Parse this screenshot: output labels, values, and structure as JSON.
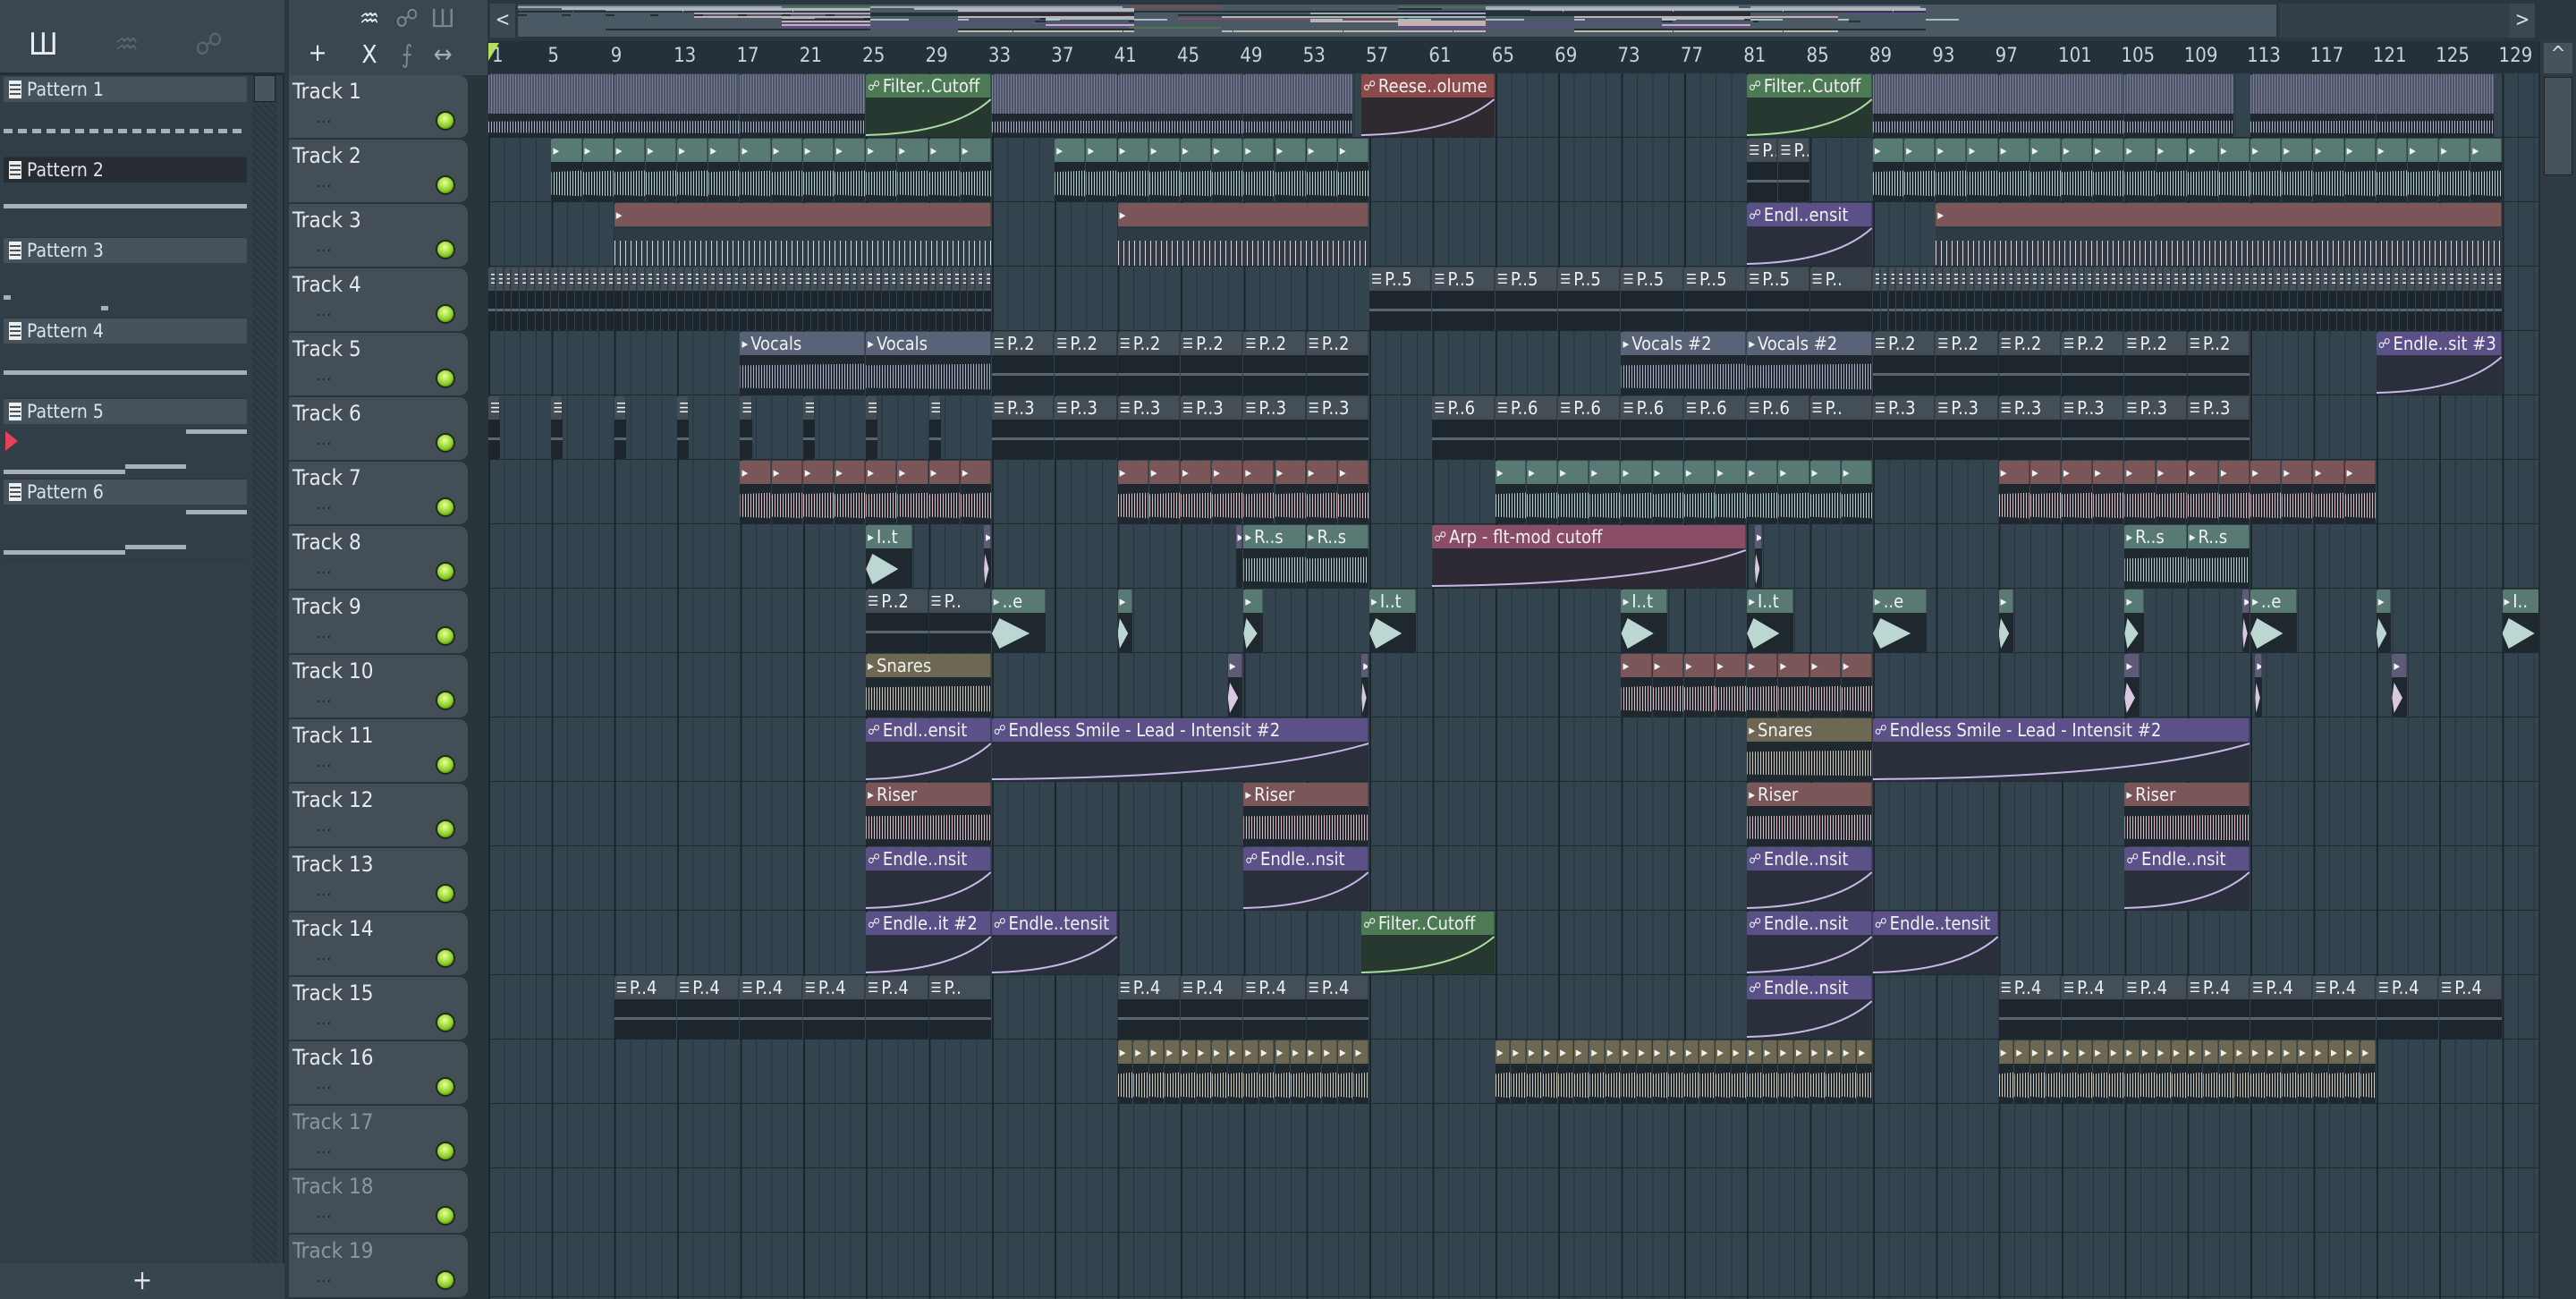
{
  "picker": {
    "icons": [
      "piano-roll-icon",
      "audio-clip-icon",
      "automation-icon"
    ],
    "patterns": [
      {
        "name": "Pattern 1",
        "selected": false
      },
      {
        "name": "Pattern 2",
        "selected": true
      },
      {
        "name": "Pattern 3",
        "selected": false
      },
      {
        "name": "Pattern 4",
        "selected": false
      },
      {
        "name": "Pattern 5",
        "selected": false
      },
      {
        "name": "Pattern 6",
        "selected": false
      }
    ],
    "add_label": "+",
    "current_marker": "Pattern 5"
  },
  "toolbar": {
    "add": "+",
    "delete": "X",
    "slice": "⨍",
    "stretch": "↔",
    "wave": "♒",
    "auto": "☍",
    "piano": "Ш"
  },
  "overview": {
    "left": "<",
    "right": ">"
  },
  "ruler": [
    "1",
    "5",
    "9",
    "13",
    "17",
    "21",
    "25",
    "29",
    "33",
    "37",
    "41",
    "45",
    "49",
    "53",
    "57",
    "61",
    "65",
    "69",
    "73",
    "77",
    "81",
    "85",
    "89",
    "93",
    "97",
    "101",
    "105",
    "109",
    "113",
    "117",
    "121",
    "125",
    "129"
  ],
  "colors": {
    "lavender": [
      "#5a6278",
      "#b4b9d2"
    ],
    "teal": [
      "#587a72",
      "#bcd6d2"
    ],
    "pink": [
      "#7a5658",
      "#e8c2ca"
    ],
    "tan": [
      "#6e6852",
      "#d8d0bc"
    ],
    "pattern": [
      "#434e56",
      "#1c262c"
    ],
    "auto_purple": [
      "#5c5088",
      "#2a2f3c"
    ],
    "auto_green": [
      "#4d7a55",
      "#273830"
    ],
    "auto_red": [
      "#8c4a4a",
      "#2e2a30"
    ],
    "auto_pink": [
      "#8a4c66",
      "#2e2a34"
    ],
    "small_purple": [
      "#5e5a78",
      "#1c262c"
    ]
  },
  "tracks": [
    {
      "name": "Track 1",
      "clips": [
        {
          "t": "audio",
          "c": "lavender",
          "s": 1,
          "l": 8,
          "n": 3
        },
        {
          "t": "auto",
          "c": "auto_green",
          "name": "Filter..Cutoff",
          "s": 25,
          "l": 8
        },
        {
          "t": "audio",
          "c": "lavender",
          "s": 33,
          "l": 8,
          "n": 2
        },
        {
          "t": "audio",
          "c": "lavender",
          "s": 49,
          "l": 7
        },
        {
          "t": "auto",
          "c": "auto_red",
          "name": "Reese..olume",
          "s": 56.5,
          "l": 8.5
        },
        {
          "t": "auto",
          "c": "auto_green",
          "name": "Filter..Cutoff",
          "s": 81,
          "l": 8
        },
        {
          "t": "audio",
          "c": "lavender",
          "s": 89,
          "l": 8,
          "n": 2
        },
        {
          "t": "audio",
          "c": "lavender",
          "s": 105,
          "l": 7
        },
        {
          "t": "audio",
          "c": "lavender",
          "s": 113,
          "l": 8
        },
        {
          "t": "audio",
          "c": "lavender",
          "s": 121,
          "l": 7.5
        }
      ]
    },
    {
      "name": "Track 2",
      "clips": [
        {
          "t": "audio",
          "c": "teal",
          "hicon": true,
          "s": 5,
          "l": 2,
          "n": 14
        },
        {
          "t": "audio",
          "c": "teal",
          "hicon": true,
          "s": 37,
          "l": 2,
          "n": 10
        },
        {
          "t": "pattern",
          "c": "pattern",
          "name": "P..2",
          "s": 81,
          "l": 2
        },
        {
          "t": "pattern",
          "c": "pattern",
          "name": "P..",
          "s": 83,
          "l": 2
        },
        {
          "t": "audio",
          "c": "teal",
          "hicon": true,
          "s": 89,
          "l": 2,
          "n": 20
        }
      ]
    },
    {
      "name": "Track 3",
      "clips": [
        {
          "t": "lines",
          "c": "pink",
          "s": 9,
          "l": 24
        },
        {
          "t": "lines",
          "c": "pink",
          "s": 41,
          "l": 16
        },
        {
          "t": "auto",
          "c": "auto_purple",
          "name": "Endl..ensit",
          "s": 81,
          "l": 8
        },
        {
          "t": "lines",
          "c": "pink",
          "s": 93,
          "l": 36
        }
      ]
    },
    {
      "name": "Track 4",
      "clips": [
        {
          "t": "pattern",
          "c": "pattern",
          "s": 1,
          "l": 0.5,
          "n": 64
        },
        {
          "t": "pattern",
          "c": "pattern",
          "name": "P..5",
          "s": 57,
          "l": 4,
          "n": 7
        },
        {
          "t": "pattern",
          "c": "pattern",
          "name": "P..",
          "s": 85,
          "l": 4
        },
        {
          "t": "pattern",
          "c": "pattern",
          "s": 89,
          "l": 0.5,
          "n": 80
        }
      ]
    },
    {
      "name": "Track 5",
      "clips": [
        {
          "t": "audio",
          "c": "lavender",
          "name": "Vocals",
          "s": 17,
          "l": 8,
          "n": 2
        },
        {
          "t": "pattern",
          "c": "pattern",
          "name": "P..2",
          "s": 33,
          "l": 4,
          "n": 6
        },
        {
          "t": "audio",
          "c": "lavender",
          "name": "Vocals #2",
          "s": 73,
          "l": 8,
          "n": 2
        },
        {
          "t": "pattern",
          "c": "pattern",
          "name": "P..2",
          "s": 89,
          "l": 4,
          "n": 6
        },
        {
          "t": "auto",
          "c": "auto_purple",
          "name": "Endle..sit #3",
          "s": 121,
          "l": 8
        }
      ]
    },
    {
      "name": "Track 6",
      "clips": [
        {
          "t": "pattern",
          "c": "pattern",
          "s": 1,
          "l": 0.8,
          "step": 4,
          "n": 8
        },
        {
          "t": "pattern",
          "c": "pattern",
          "name": "P..3",
          "s": 33,
          "l": 4,
          "n": 6
        },
        {
          "t": "pattern",
          "c": "pattern",
          "name": "P..6",
          "s": 61,
          "l": 4,
          "n": 6
        },
        {
          "t": "pattern",
          "c": "pattern",
          "name": "P..",
          "s": 85,
          "l": 4
        },
        {
          "t": "pattern",
          "c": "pattern",
          "name": "P..3",
          "s": 89,
          "l": 4,
          "n": 6
        }
      ]
    },
    {
      "name": "Track 7",
      "clips": [
        {
          "t": "audio",
          "c": "pink",
          "hicon": true,
          "s": 17,
          "l": 2,
          "n": 8
        },
        {
          "t": "audio",
          "c": "pink",
          "hicon": true,
          "s": 41,
          "l": 2,
          "n": 8
        },
        {
          "t": "audio",
          "c": "teal",
          "hicon": true,
          "s": 65,
          "l": 2,
          "n": 12
        },
        {
          "t": "audio",
          "c": "pink",
          "hicon": true,
          "s": 97,
          "l": 2,
          "n": 12
        }
      ]
    },
    {
      "name": "Track 8",
      "clips": [
        {
          "t": "hit",
          "c": "teal",
          "name": "I..t",
          "s": 25,
          "l": 3
        },
        {
          "t": "hit",
          "c": "small_purple",
          "s": 32.5,
          "l": 0.5
        },
        {
          "t": "audio",
          "c": "small_purple",
          "s": 48.5,
          "l": 0.5
        },
        {
          "t": "audio",
          "c": "teal",
          "name": "R..s",
          "s": 49,
          "l": 4,
          "n": 2
        },
        {
          "t": "auto",
          "c": "auto_pink",
          "name": "Arp - flt-mod cutoff",
          "s": 61,
          "l": 20
        },
        {
          "t": "hit",
          "c": "small_purple",
          "s": 81.5,
          "l": 0.5
        },
        {
          "t": "audio",
          "c": "teal",
          "name": "R..s",
          "s": 105,
          "l": 4,
          "n": 2
        }
      ]
    },
    {
      "name": "Track 9",
      "clips": [
        {
          "t": "pattern",
          "c": "pattern",
          "name": "P..2",
          "s": 25,
          "l": 4
        },
        {
          "t": "pattern",
          "c": "pattern",
          "name": "P..",
          "s": 29,
          "l": 4
        },
        {
          "t": "hit",
          "c": "teal",
          "name": "..e",
          "s": 33,
          "l": 3.5
        },
        {
          "t": "hit",
          "c": "teal",
          "s": 41,
          "l": 1
        },
        {
          "t": "hit",
          "c": "teal",
          "s": 49,
          "l": 1.3
        },
        {
          "t": "hit",
          "c": "teal",
          "name": "I..t",
          "s": 57,
          "l": 3
        },
        {
          "t": "hit",
          "c": "teal",
          "name": "I..t",
          "s": 73,
          "l": 3
        },
        {
          "t": "hit",
          "c": "teal",
          "name": "I..t",
          "s": 81,
          "l": 3
        },
        {
          "t": "hit",
          "c": "teal",
          "name": "..e",
          "s": 89,
          "l": 3.5
        },
        {
          "t": "hit",
          "c": "teal",
          "s": 97,
          "l": 1
        },
        {
          "t": "hit",
          "c": "teal",
          "s": 105,
          "l": 1.3
        },
        {
          "t": "hit",
          "c": "small_purple",
          "s": 112.5,
          "l": 0.5
        },
        {
          "t": "hit",
          "c": "teal",
          "name": "..e",
          "s": 113,
          "l": 3
        },
        {
          "t": "hit",
          "c": "teal",
          "s": 121,
          "l": 1
        },
        {
          "t": "hit",
          "c": "teal",
          "name": "I..",
          "s": 129,
          "l": 3
        }
      ]
    },
    {
      "name": "Track 10",
      "clips": [
        {
          "t": "audio",
          "c": "tan",
          "name": "Snares",
          "s": 25,
          "l": 8
        },
        {
          "t": "hit",
          "c": "small_purple",
          "s": 48,
          "l": 1
        },
        {
          "t": "hit",
          "c": "small_purple",
          "s": 56.5,
          "l": 0.5
        },
        {
          "t": "audio",
          "c": "pink",
          "hicon": true,
          "s": 73,
          "l": 2,
          "n": 8
        },
        {
          "t": "hit",
          "c": "small_purple",
          "s": 105,
          "l": 1
        },
        {
          "t": "hit",
          "c": "small_purple",
          "s": 113.3,
          "l": 0.5
        },
        {
          "t": "hit",
          "c": "small_purple",
          "s": 122,
          "l": 1
        }
      ]
    },
    {
      "name": "Track 11",
      "clips": [
        {
          "t": "auto",
          "c": "auto_purple",
          "name": "Endl..ensit",
          "s": 25,
          "l": 8
        },
        {
          "t": "auto",
          "c": "auto_purple",
          "name": "Endless Smile - Lead - Intensit #2",
          "s": 33,
          "l": 24
        },
        {
          "t": "audio",
          "c": "tan",
          "name": "Snares",
          "s": 81,
          "l": 8
        },
        {
          "t": "auto",
          "c": "auto_purple",
          "name": "Endless Smile - Lead - Intensit #2",
          "s": 89,
          "l": 24
        }
      ]
    },
    {
      "name": "Track 12",
      "clips": [
        {
          "t": "audio",
          "c": "pink",
          "name": "Riser",
          "s": 25,
          "l": 8
        },
        {
          "t": "audio",
          "c": "pink",
          "name": "Riser",
          "s": 49,
          "l": 8
        },
        {
          "t": "audio",
          "c": "pink",
          "name": "Riser",
          "s": 81,
          "l": 8
        },
        {
          "t": "audio",
          "c": "pink",
          "name": "Riser",
          "s": 105,
          "l": 8
        }
      ]
    },
    {
      "name": "Track 13",
      "clips": [
        {
          "t": "auto",
          "c": "auto_purple",
          "name": "Endle..nsit",
          "s": 25,
          "l": 8
        },
        {
          "t": "auto",
          "c": "auto_purple",
          "name": "Endle..nsit",
          "s": 49,
          "l": 8
        },
        {
          "t": "auto",
          "c": "auto_purple",
          "name": "Endle..nsit",
          "s": 81,
          "l": 8
        },
        {
          "t": "auto",
          "c": "auto_purple",
          "name": "Endle..nsit",
          "s": 105,
          "l": 8
        }
      ]
    },
    {
      "name": "Track 14",
      "clips": [
        {
          "t": "auto",
          "c": "auto_purple",
          "name": "Endle..it #2",
          "s": 25,
          "l": 8
        },
        {
          "t": "auto",
          "c": "auto_purple",
          "name": "Endle..tensit",
          "s": 33,
          "l": 8
        },
        {
          "t": "auto",
          "c": "auto_green",
          "name": "Filter..Cutoff",
          "s": 56.5,
          "l": 8.5
        },
        {
          "t": "auto",
          "c": "auto_purple",
          "name": "Endle..nsit",
          "s": 81,
          "l": 8
        },
        {
          "t": "auto",
          "c": "auto_purple",
          "name": "Endle..tensit",
          "s": 89,
          "l": 8
        }
      ]
    },
    {
      "name": "Track 15",
      "clips": [
        {
          "t": "pattern",
          "c": "pattern",
          "name": "P..4",
          "s": 9,
          "l": 4,
          "n": 5
        },
        {
          "t": "pattern",
          "c": "pattern",
          "name": "P..",
          "s": 29,
          "l": 4
        },
        {
          "t": "pattern",
          "c": "pattern",
          "name": "P..4",
          "s": 41,
          "l": 4,
          "n": 4
        },
        {
          "t": "auto",
          "c": "auto_purple",
          "name": "Endle..nsit",
          "s": 81,
          "l": 8
        },
        {
          "t": "pattern",
          "c": "pattern",
          "name": "P..4",
          "s": 97,
          "l": 4,
          "n": 8
        }
      ]
    },
    {
      "name": "Track 16",
      "clips": [
        {
          "t": "audio",
          "c": "tan",
          "hicon": true,
          "s": 41,
          "l": 1,
          "n": 16
        },
        {
          "t": "audio",
          "c": "tan",
          "hicon": true,
          "s": 65,
          "l": 1,
          "n": 24
        },
        {
          "t": "audio",
          "c": "tan",
          "hicon": true,
          "s": 97,
          "l": 1,
          "n": 24
        }
      ]
    },
    {
      "name": "Track 17",
      "dim": true,
      "clips": []
    },
    {
      "name": "Track 18",
      "dim": true,
      "clips": []
    },
    {
      "name": "Track 19",
      "dim": true,
      "clips": []
    }
  ]
}
